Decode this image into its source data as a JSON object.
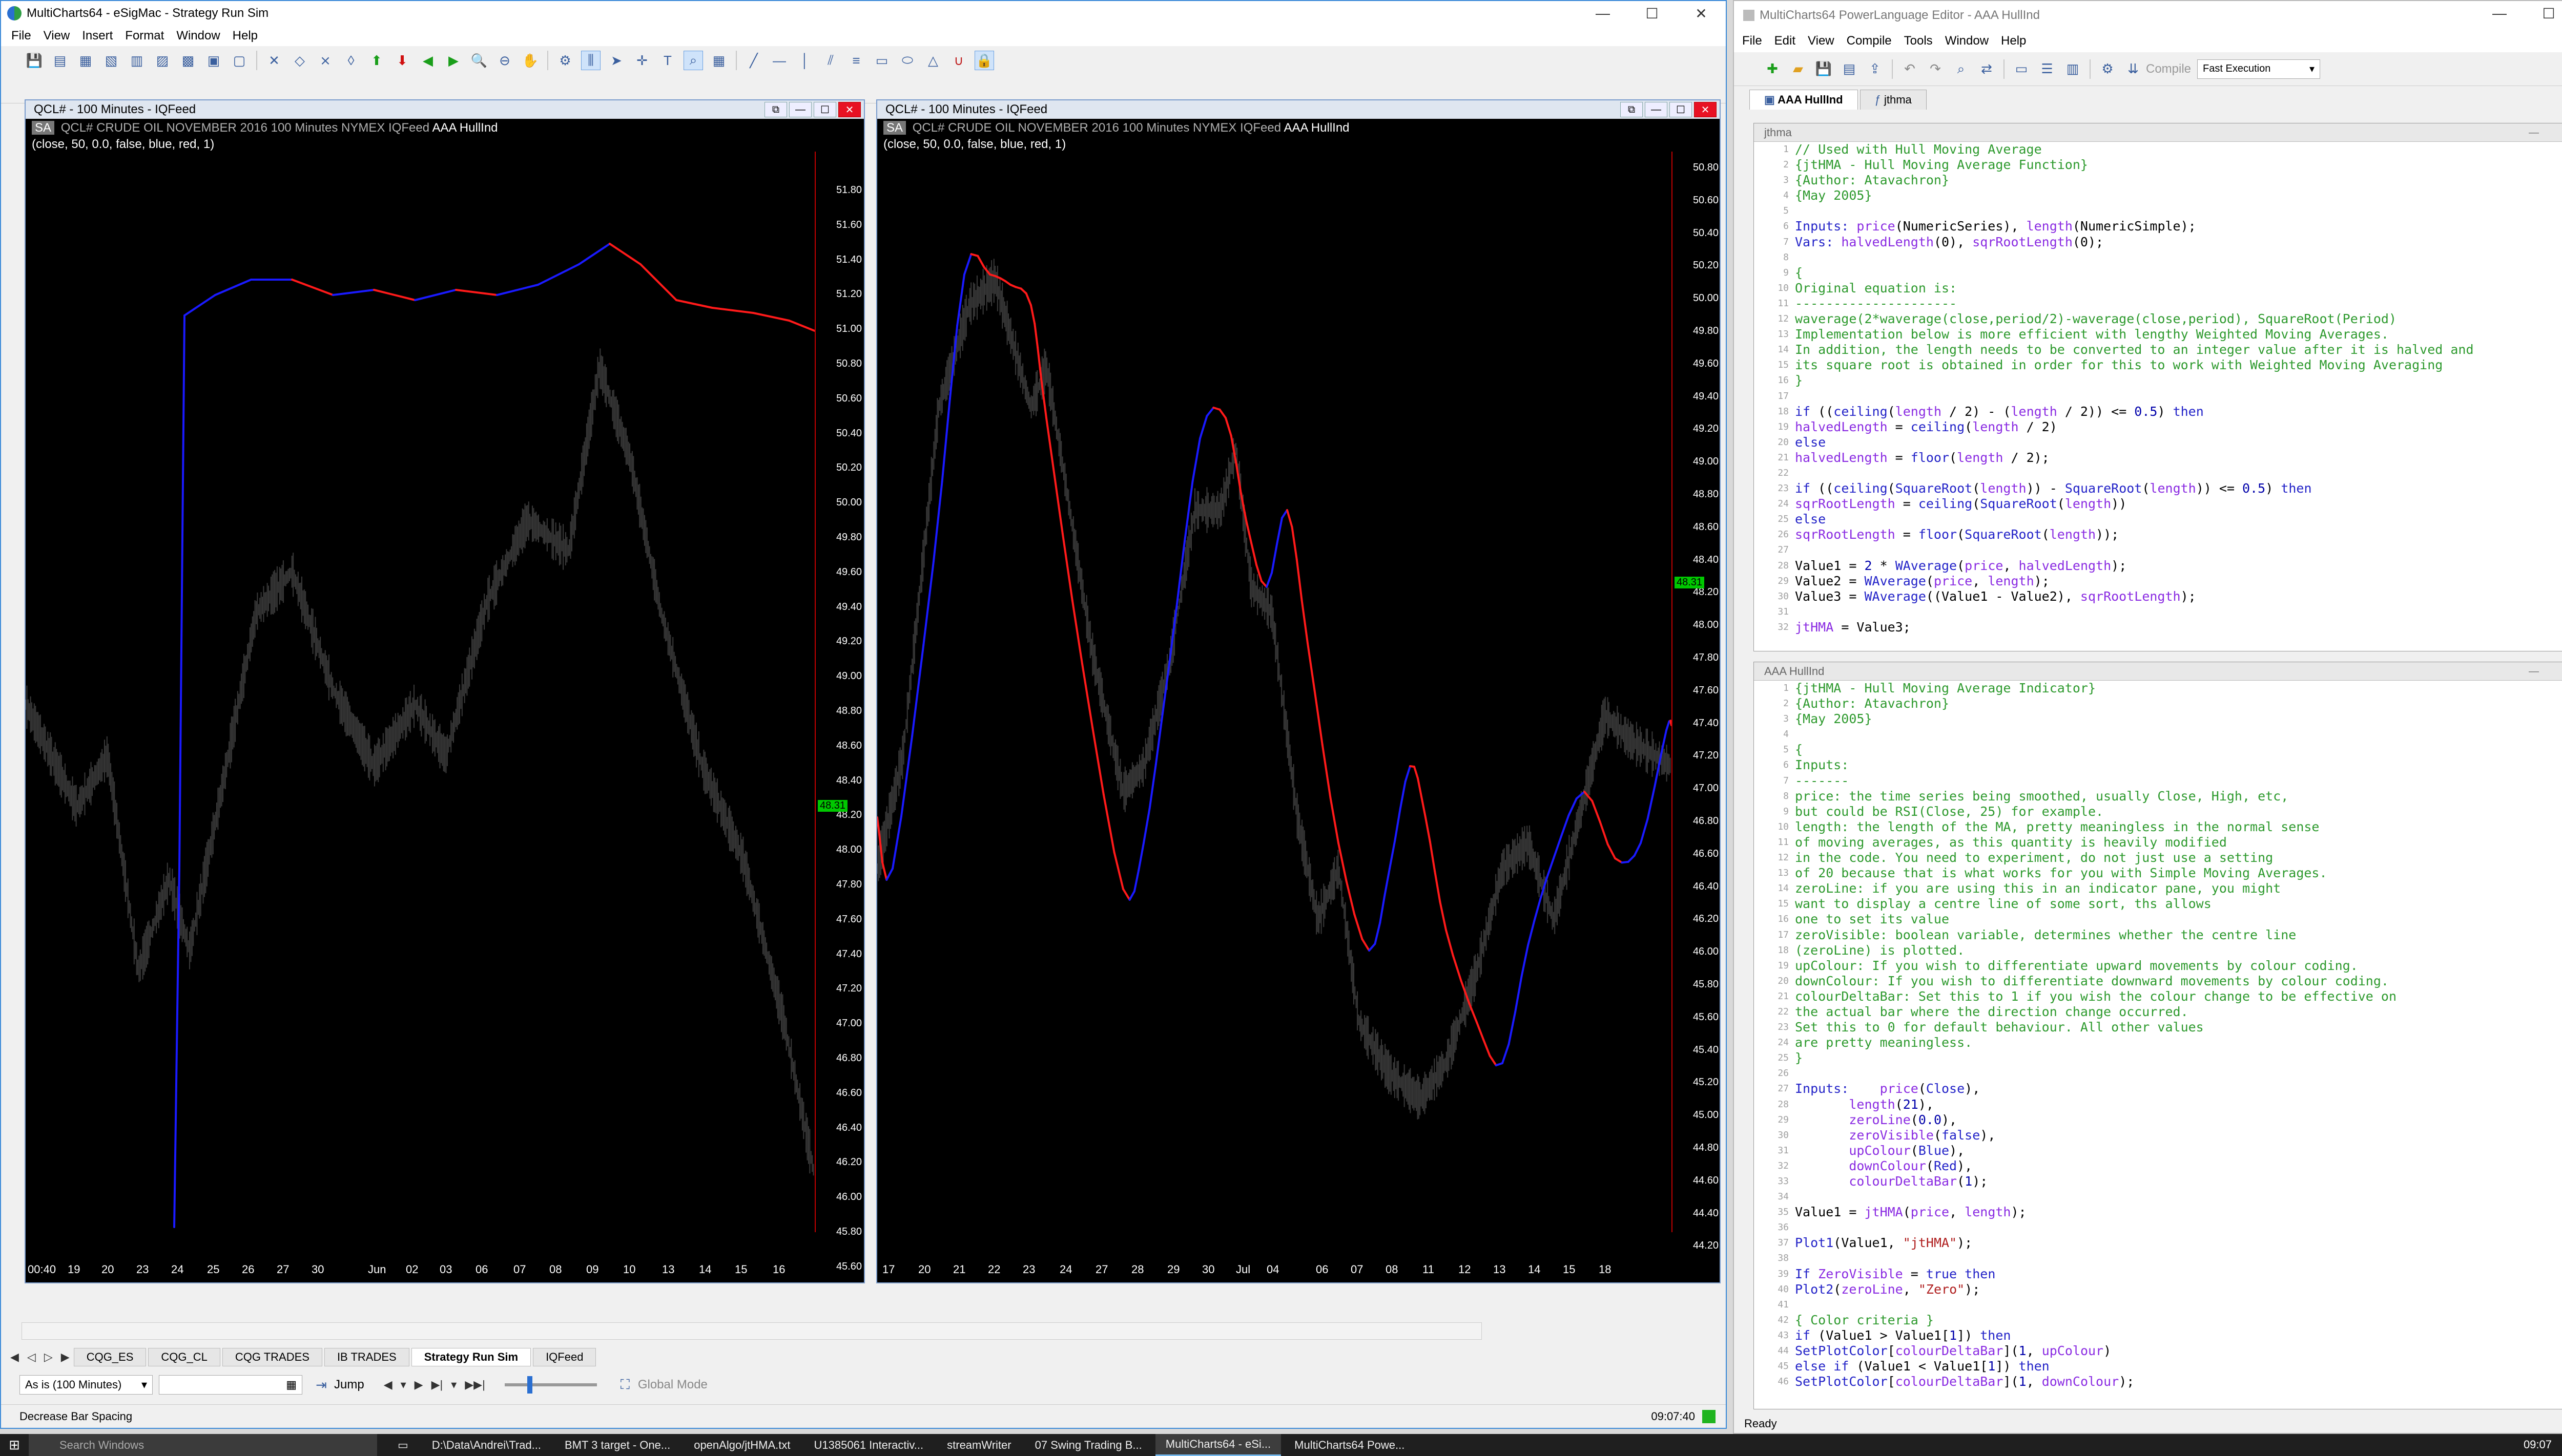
{
  "mc": {
    "title": "MultiCharts64 - eSigMac - Strategy Run Sim",
    "menu": [
      "File",
      "View",
      "Insert",
      "Format",
      "Window",
      "Help"
    ],
    "pane_caption": "QCL# - 100 Minutes - IQFeed",
    "hdr_sa": "SA",
    "hdr_symbol": "QCL#",
    "hdr_desc": "CRUDE OIL NOVEMBER 2016  100 Minutes",
    "hdr_exchange": "NYMEX  IQFeed",
    "hdr_study": "AAA HullInd",
    "study_inputs": "(close, 50, 0.0, false, blue, red, 1)",
    "left_yaxis": [
      "51.80",
      "51.60",
      "51.40",
      "51.20",
      "51.00",
      "50.80",
      "50.60",
      "50.40",
      "50.20",
      "50.00",
      "49.80",
      "49.60",
      "49.40",
      "49.20",
      "49.00",
      "48.80",
      "48.60",
      "48.40",
      "48.20",
      "48.00",
      "47.80",
      "47.60",
      "47.40",
      "47.20",
      "47.00",
      "46.80",
      "46.60",
      "46.40",
      "46.20",
      "46.00",
      "45.80",
      "45.60"
    ],
    "left_price_tag": "48.31",
    "left_xaxis": [
      "00:40",
      "19",
      "20",
      "23",
      "24",
      "25",
      "26",
      "27",
      "30",
      "Jun",
      "02",
      "03",
      "06",
      "07",
      "08",
      "09",
      "10",
      "13",
      "14",
      "15",
      "16"
    ],
    "right_yaxis": [
      "50.80",
      "50.60",
      "50.40",
      "50.20",
      "50.00",
      "49.80",
      "49.60",
      "49.40",
      "49.20",
      "49.00",
      "48.80",
      "48.60",
      "48.40",
      "48.20",
      "48.00",
      "47.80",
      "47.60",
      "47.40",
      "47.20",
      "47.00",
      "46.80",
      "46.60",
      "46.40",
      "46.20",
      "46.00",
      "45.80",
      "45.60",
      "45.40",
      "45.20",
      "45.00",
      "44.80",
      "44.60",
      "44.40",
      "44.20"
    ],
    "right_price_tag": "48.31",
    "right_xaxis": [
      "17",
      "20",
      "21",
      "22",
      "23",
      "24",
      "27",
      "28",
      "29",
      "30",
      "Jul",
      "04",
      "06",
      "07",
      "08",
      "11",
      "12",
      "13",
      "14",
      "15",
      "18"
    ],
    "tabs": [
      "CQG_ES",
      "CQG_CL",
      "CQG TRADES",
      "IB TRADES",
      "Strategy Run Sim",
      "IQFeed"
    ],
    "active_tab": "Strategy Run Sim",
    "resolution": "As is (100 Minutes)",
    "jump": "Jump",
    "global_mode": "Global Mode",
    "status_left": "Decrease Bar Spacing",
    "status_time": "09:07:40",
    "colors": {
      "up": "#1a1aff",
      "down": "#ff1a1a"
    }
  },
  "pl": {
    "title": "MultiCharts64 PowerLanguage Editor - AAA HullInd",
    "menu": [
      "File",
      "Edit",
      "View",
      "Compile",
      "Tools",
      "Window",
      "Help"
    ],
    "compile_label": "Compile",
    "compile_mode": "Fast Execution",
    "tabs": [
      "AAA HullInd",
      "jthma"
    ],
    "ed1_caption": "jthma",
    "ed2_caption": "AAA HullInd",
    "status": "Ready"
  },
  "taskbar": {
    "search": "Search Windows",
    "apps": [
      "D:\\Data\\Andrei\\Trad...",
      "BMT 3 target - One...",
      "openAlgo/jtHMA.txt",
      "U1385061 Interactiv...",
      "streamWriter",
      "07 Swing Trading B...",
      "MultiCharts64 - eSi...",
      "MultiCharts64 Powe..."
    ],
    "clock": "09:07"
  }
}
